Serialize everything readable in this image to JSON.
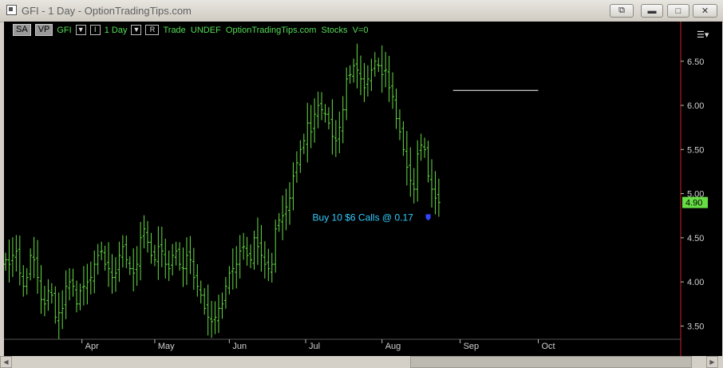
{
  "window": {
    "title": "GFI - 1 Day - OptionTradingTips.com",
    "buttons": [
      "restore-icon",
      "minimize-icon",
      "maximize-icon",
      "close-icon"
    ]
  },
  "toolbar": {
    "sa_label": "SA",
    "vp_label": "VP",
    "symbol": "GFI",
    "interval": "1 Day",
    "r_label": "R",
    "info_text": "Trade  UNDEF  OptionTradingTips.com  Stocks  V=0"
  },
  "colors": {
    "background": "#000000",
    "bars": "#66dd44",
    "axis_labels": "#d0d0d0",
    "price_box": "#66dd44",
    "annotation": "#33ccff",
    "marker": "#3344ff",
    "hline": "#ffffff",
    "right_border": "#cc2222"
  },
  "chart_data": {
    "type": "ohlc",
    "symbol": "GFI",
    "interval": "1 Day",
    "ylim": [
      3.35,
      6.95
    ],
    "yticks": [
      3.5,
      4.0,
      4.5,
      5.0,
      5.5,
      6.0,
      6.5
    ],
    "ytick_labels": [
      "3.50",
      "4.00",
      "4.50",
      "5.00",
      "5.50",
      "6.00",
      "6.50"
    ],
    "month_labels": [
      "Apr",
      "May",
      "Jun",
      "Jul",
      "Aug",
      "Sep",
      "Oct"
    ],
    "month_positions": [
      21.5,
      42,
      63,
      84.5,
      106,
      128,
      150
    ],
    "x_range": [
      0,
      168
    ],
    "last_price": "4.90",
    "closes": [
      4.25,
      4.2,
      4.3,
      4.35,
      4.1,
      3.95,
      4.05,
      4.3,
      4.25,
      4.05,
      3.8,
      3.75,
      3.9,
      3.85,
      3.6,
      3.65,
      3.7,
      3.95,
      4.0,
      3.95,
      3.75,
      3.9,
      3.95,
      4.0,
      4.05,
      4.2,
      4.3,
      4.35,
      4.2,
      4.15,
      4.05,
      4.1,
      4.3,
      4.4,
      4.25,
      4.15,
      4.1,
      4.2,
      4.5,
      4.6,
      4.45,
      4.3,
      4.25,
      4.4,
      4.35,
      4.2,
      4.15,
      4.3,
      4.35,
      4.2,
      4.15,
      4.3,
      4.25,
      4.05,
      3.95,
      3.85,
      3.7,
      3.6,
      3.55,
      3.6,
      3.7,
      3.75,
      3.95,
      4.1,
      4.15,
      4.2,
      4.35,
      4.4,
      4.3,
      4.25,
      4.5,
      4.4,
      4.3,
      4.2,
      4.15,
      4.2,
      4.6,
      4.7,
      4.75,
      4.85,
      4.95,
      5.2,
      5.35,
      5.5,
      5.6,
      5.8,
      5.7,
      5.9,
      6.0,
      5.95,
      5.9,
      5.8,
      5.65,
      5.6,
      5.75,
      5.95,
      6.3,
      6.35,
      6.45,
      6.4,
      6.3,
      6.2,
      6.3,
      6.4,
      6.5,
      6.45,
      6.35,
      6.4,
      6.2,
      6.1,
      5.85,
      5.7,
      5.5,
      5.3,
      5.15,
      5.05,
      5.45,
      5.55,
      5.5,
      5.2,
      5.05,
      4.95,
      4.9
    ],
    "annotations": [
      {
        "text": "Buy 10 $6 Calls @ 0.17",
        "x": 119,
        "y": 4.73
      },
      {
        "type": "hline",
        "y": 6.17,
        "x_start": 126,
        "x_end": 150
      }
    ]
  }
}
